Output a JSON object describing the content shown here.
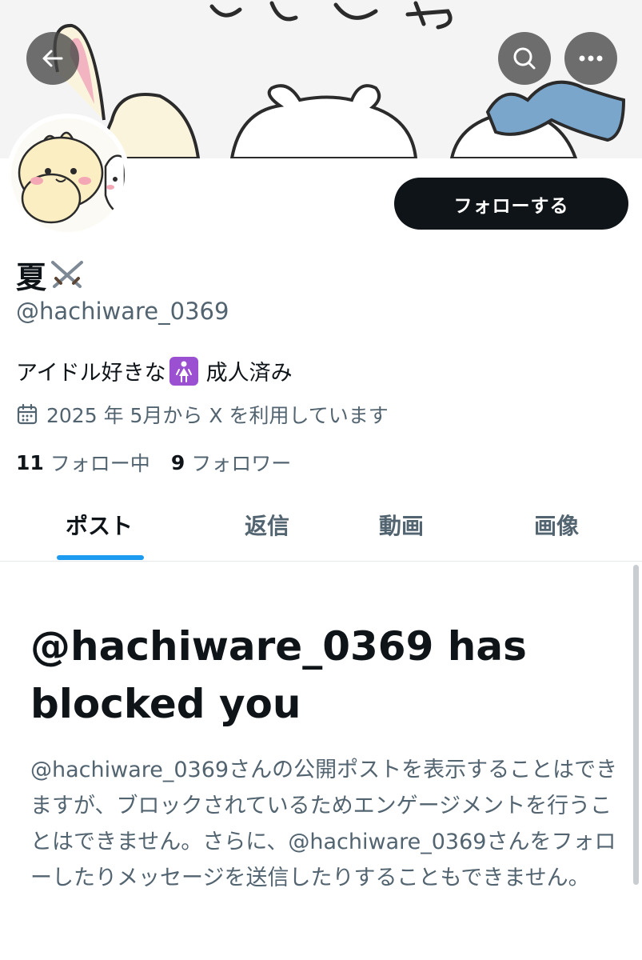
{
  "header": {
    "back_icon": "arrow-left-icon",
    "search_icon": "search-icon",
    "more_icon": "more-horizontal-icon",
    "banner_text": "ちいかわ"
  },
  "profile": {
    "display_name": "夏",
    "name_emoji": "crossed-swords-icon",
    "handle": "@hachiware_0369",
    "follow_label": "フォローする",
    "bio_before": "アイドル好きな",
    "bio_emoji": "woman-symbol-icon",
    "bio_after": "成人済み",
    "joined_icon": "calendar-icon",
    "joined_text": "2025 年 5月から X を利用しています",
    "following_count": "11",
    "following_label": "フォロー中",
    "followers_count": "9",
    "followers_label": "フォロワー"
  },
  "tabs": [
    {
      "label": "ポスト",
      "active": true
    },
    {
      "label": "返信",
      "active": false
    },
    {
      "label": "動画",
      "active": false
    },
    {
      "label": "画像",
      "active": false
    }
  ],
  "blocked": {
    "title": "@hachiware_0369 has blocked you",
    "description": "@hachiware_0369さんの公開ポストを表示することはできますが、ブロックされているためエンゲージメントを行うことはできません。さらに、@hachiware_0369さんをフォローしたりメッセージを送信したりすることもできません。"
  },
  "colors": {
    "accent": "#1d9bf0",
    "text_primary": "#0f1419",
    "text_secondary": "#536471",
    "follow_button": "#0f1419"
  }
}
